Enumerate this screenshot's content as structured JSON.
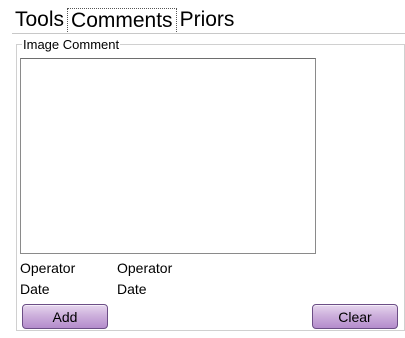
{
  "tabs": [
    {
      "label": "Tools",
      "active": false
    },
    {
      "label": "Comments",
      "active": true
    },
    {
      "label": "Priors",
      "active": false
    }
  ],
  "comments": {
    "group_title": "Image Comment",
    "comment_text": "",
    "operator_label": "Operator",
    "operator_value": "Operator",
    "date_label": "Date",
    "date_value": "Date",
    "add_label": "Add",
    "clear_label": "Clear"
  },
  "colors": {
    "button_purple": "#c7a6d9",
    "button_border": "#6c4e86"
  }
}
